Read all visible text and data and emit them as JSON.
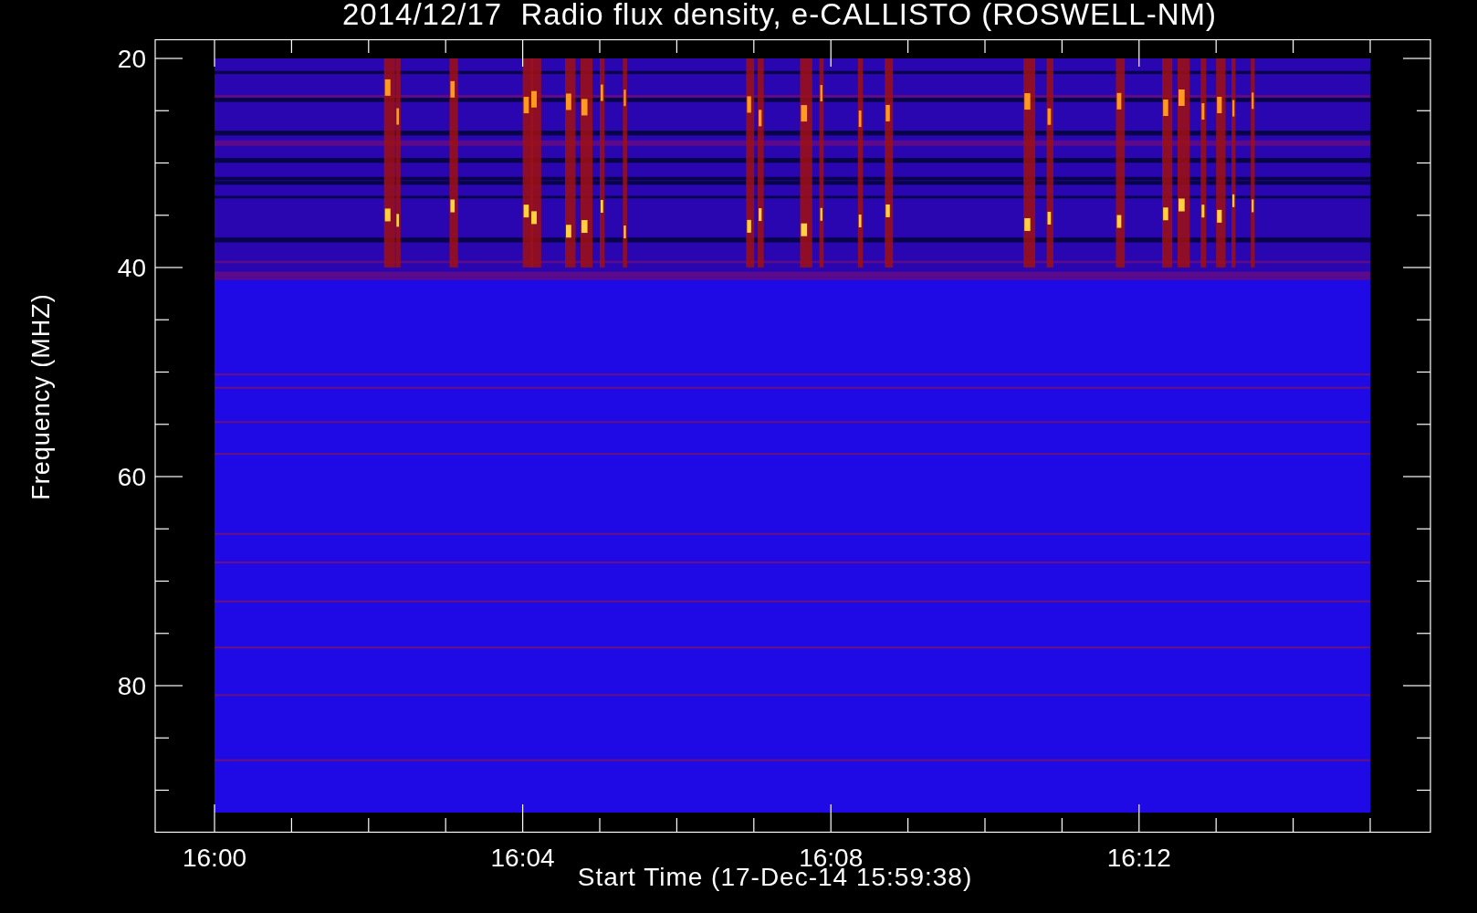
{
  "title": "2014/12/17  Radio flux density, e-CALLISTO (ROSWELL-NM)",
  "y_axis": {
    "label": "Frequency (MHZ)",
    "ticks": [
      "20",
      "40",
      "60",
      "80"
    ]
  },
  "x_axis": {
    "label": "Start Time (17-Dec-14 15:59:38)",
    "ticks": [
      "16:00",
      "16:04",
      "16:08",
      "16:12"
    ]
  }
}
